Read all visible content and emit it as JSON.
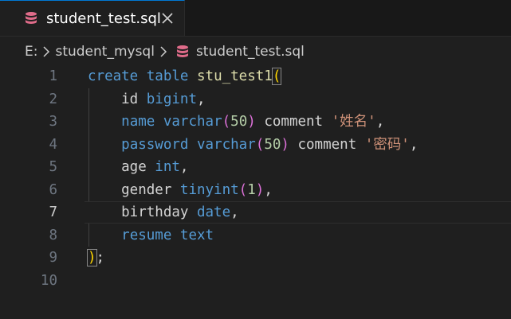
{
  "tab": {
    "filename": "student_test.sql",
    "close_glyph": "✕"
  },
  "breadcrumb": {
    "drive": "E:",
    "folder": "student_mysql",
    "file": "student_test.sql"
  },
  "editor": {
    "active_line": 7,
    "line_numbers": [
      "1",
      "2",
      "3",
      "4",
      "5",
      "6",
      "7",
      "8",
      "9",
      "10"
    ],
    "lines": [
      [
        {
          "t": "create",
          "c": "kw"
        },
        {
          "t": " ",
          "c": "ident"
        },
        {
          "t": "table",
          "c": "kw"
        },
        {
          "t": " ",
          "c": "ident"
        },
        {
          "t": "stu_test1",
          "c": "id"
        },
        {
          "t": "(",
          "c": "p1 bracket-box"
        }
      ],
      [
        {
          "t": "    id ",
          "c": "ident"
        },
        {
          "t": "bigint",
          "c": "kw"
        },
        {
          "t": ",",
          "c": "ident"
        }
      ],
      [
        {
          "t": "    ",
          "c": "ident"
        },
        {
          "t": "name",
          "c": "kw"
        },
        {
          "t": " ",
          "c": "ident"
        },
        {
          "t": "varchar",
          "c": "kw"
        },
        {
          "t": "(",
          "c": "p2"
        },
        {
          "t": "50",
          "c": "num"
        },
        {
          "t": ")",
          "c": "p2"
        },
        {
          "t": " comment ",
          "c": "ident"
        },
        {
          "t": "'姓名'",
          "c": "str"
        },
        {
          "t": ",",
          "c": "ident"
        }
      ],
      [
        {
          "t": "    ",
          "c": "ident"
        },
        {
          "t": "password",
          "c": "kw"
        },
        {
          "t": " ",
          "c": "ident"
        },
        {
          "t": "varchar",
          "c": "kw"
        },
        {
          "t": "(",
          "c": "p2"
        },
        {
          "t": "50",
          "c": "num"
        },
        {
          "t": ")",
          "c": "p2"
        },
        {
          "t": " comment ",
          "c": "ident"
        },
        {
          "t": "'密码'",
          "c": "str"
        },
        {
          "t": ",",
          "c": "ident"
        }
      ],
      [
        {
          "t": "    age ",
          "c": "ident"
        },
        {
          "t": "int",
          "c": "kw"
        },
        {
          "t": ",",
          "c": "ident"
        }
      ],
      [
        {
          "t": "    gender ",
          "c": "ident"
        },
        {
          "t": "tinyint",
          "c": "kw"
        },
        {
          "t": "(",
          "c": "p2"
        },
        {
          "t": "1",
          "c": "num"
        },
        {
          "t": ")",
          "c": "p2"
        },
        {
          "t": ",",
          "c": "ident"
        }
      ],
      [
        {
          "t": "    birthday ",
          "c": "ident"
        },
        {
          "t": "date",
          "c": "kw"
        },
        {
          "t": ",",
          "c": "ident"
        }
      ],
      [
        {
          "t": "    ",
          "c": "ident"
        },
        {
          "t": "resume",
          "c": "kw"
        },
        {
          "t": " ",
          "c": "ident"
        },
        {
          "t": "text",
          "c": "kw"
        }
      ],
      [
        {
          "t": ")",
          "c": "p1 bracket-box"
        },
        {
          "t": ";",
          "c": "ident"
        }
      ],
      []
    ]
  },
  "colors": {
    "background": "#1f1f1f",
    "keyword": "#569cd6",
    "identifier": "#dcdcaa",
    "number": "#b5cea8",
    "string": "#ce9178",
    "bracket_level1": "#ffd700",
    "bracket_level2": "#da70d6",
    "database_icon": "#e06c8a"
  },
  "icons": {
    "tab_file": "database-icon",
    "breadcrumb_file": "database-icon",
    "close": "close-icon",
    "separator": "chevron-right-icon"
  }
}
